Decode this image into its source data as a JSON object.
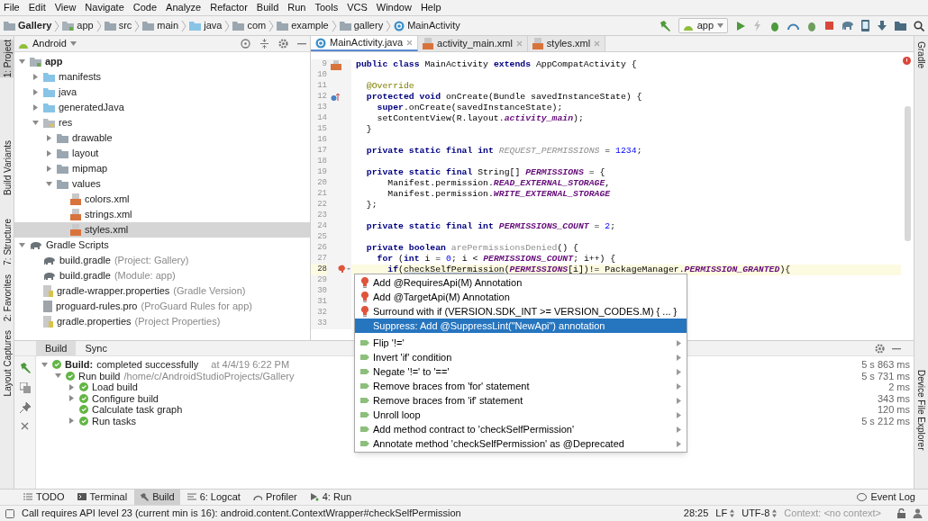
{
  "menu": [
    "File",
    "Edit",
    "View",
    "Navigate",
    "Code",
    "Analyze",
    "Refactor",
    "Build",
    "Run",
    "Tools",
    "VCS",
    "Window",
    "Help"
  ],
  "breadcrumbs": [
    {
      "label": "Gallery",
      "kind": "project"
    },
    {
      "label": "app",
      "kind": "module"
    },
    {
      "label": "src",
      "kind": "folder"
    },
    {
      "label": "main",
      "kind": "folder"
    },
    {
      "label": "java",
      "kind": "source"
    },
    {
      "label": "com",
      "kind": "folder"
    },
    {
      "label": "example",
      "kind": "folder"
    },
    {
      "label": "gallery",
      "kind": "folder"
    },
    {
      "label": "MainActivity",
      "kind": "class"
    }
  ],
  "run_config": "app",
  "left_strip": [
    {
      "label": "1: Project",
      "selected": true
    },
    {
      "label": "Build Variants",
      "selected": false
    },
    {
      "label": "7: Structure",
      "selected": false
    },
    {
      "label": "2: Favorites",
      "selected": false
    },
    {
      "label": "Layout Captures",
      "selected": false
    }
  ],
  "right_strip": [
    {
      "label": "Gradle",
      "selected": false
    },
    {
      "label": "Device File Explorer",
      "selected": false
    }
  ],
  "project_panel": {
    "view": "Android",
    "tree": [
      {
        "label": "app",
        "kind": "module",
        "expanded": true,
        "selected": false,
        "children": [
          {
            "label": "manifests",
            "kind": "source",
            "expanded": false,
            "selected": false
          },
          {
            "label": "java",
            "kind": "source",
            "expanded": false,
            "selected": false
          },
          {
            "label": "generatedJava",
            "kind": "source",
            "expanded": false,
            "selected": false
          },
          {
            "label": "res",
            "kind": "res",
            "expanded": true,
            "selected": false,
            "children": [
              {
                "label": "drawable",
                "kind": "folder",
                "expanded": false,
                "selected": false
              },
              {
                "label": "layout",
                "kind": "folder",
                "expanded": false,
                "selected": false
              },
              {
                "label": "mipmap",
                "kind": "folder",
                "expanded": false,
                "selected": false
              },
              {
                "label": "values",
                "kind": "folder",
                "expanded": true,
                "selected": false,
                "children": [
                  {
                    "label": "colors.xml",
                    "kind": "xml",
                    "selected": false
                  },
                  {
                    "label": "strings.xml",
                    "kind": "xml",
                    "selected": false
                  },
                  {
                    "label": "styles.xml",
                    "kind": "xml",
                    "selected": true
                  }
                ]
              }
            ]
          }
        ]
      },
      {
        "label": "Gradle Scripts",
        "kind": "gradle",
        "expanded": true,
        "selected": false,
        "children": [
          {
            "label": "build.gradle",
            "note": "(Project: Gallery)",
            "kind": "gradle",
            "selected": false
          },
          {
            "label": "build.gradle",
            "note": "(Module: app)",
            "kind": "gradle",
            "selected": false
          },
          {
            "label": "gradle-wrapper.properties",
            "note": "(Gradle Version)",
            "kind": "props",
            "selected": false
          },
          {
            "label": "proguard-rules.pro",
            "note": "(ProGuard Rules for app)",
            "kind": "file",
            "selected": false
          },
          {
            "label": "gradle.properties",
            "note": "(Project Properties)",
            "kind": "props",
            "selected": false
          }
        ]
      }
    ]
  },
  "editor": {
    "tabs": [
      {
        "label": "MainActivity.java",
        "kind": "class",
        "selected": true
      },
      {
        "label": "activity_main.xml",
        "kind": "xml",
        "selected": false
      },
      {
        "label": "styles.xml",
        "kind": "xml",
        "selected": false
      }
    ],
    "lines": [
      {
        "number": "9",
        "kind": "layout",
        "current": false,
        "tokens": [
          {
            "text": "public class ",
            "kind": "kw"
          },
          {
            "text": "MainActivity ",
            "kind": "plain"
          },
          {
            "text": "extends ",
            "kind": "kw"
          },
          {
            "text": "AppCompatActivity {",
            "kind": "plain"
          }
        ]
      },
      {
        "number": "10",
        "kind": "plain",
        "current": false
      },
      {
        "number": "11",
        "kind": "plain",
        "current": false,
        "tokens": [
          {
            "text": "  @Override",
            "kind": "anno"
          }
        ]
      },
      {
        "number": "12",
        "kind": "override",
        "current": false,
        "tokens": [
          {
            "text": "  protected void ",
            "kind": "kw"
          },
          {
            "text": "onCreate(Bundle savedInstanceState) {",
            "kind": "plain"
          }
        ]
      },
      {
        "number": "13",
        "kind": "plain",
        "current": false,
        "tokens": [
          {
            "text": "    super",
            "kind": "kw"
          },
          {
            "text": ".onCreate(savedInstanceState);",
            "kind": "plain"
          }
        ]
      },
      {
        "number": "14",
        "kind": "plain",
        "current": false,
        "tokens": [
          {
            "text": "    setContentView(R.layout.",
            "kind": "plain"
          },
          {
            "text": "activity_main",
            "kind": "const"
          },
          {
            "text": ");",
            "kind": "plain"
          }
        ]
      },
      {
        "number": "15",
        "kind": "plain",
        "current": false,
        "tokens": [
          {
            "text": "  }",
            "kind": "plain"
          }
        ]
      },
      {
        "number": "16",
        "kind": "plain",
        "current": false
      },
      {
        "number": "17",
        "kind": "plain",
        "current": false,
        "tokens": [
          {
            "text": "  private static final int ",
            "kind": "kw"
          },
          {
            "text": "REQUEST_PERMISSIONS",
            "kind": "unused_field"
          },
          {
            "text": " = ",
            "kind": "plain"
          },
          {
            "text": "1234",
            "kind": "num"
          },
          {
            "text": ";",
            "kind": "plain"
          }
        ]
      },
      {
        "number": "18",
        "kind": "plain",
        "current": false
      },
      {
        "number": "19",
        "kind": "plain",
        "current": false,
        "tokens": [
          {
            "text": "  private static final ",
            "kind": "kw"
          },
          {
            "text": "String[] ",
            "kind": "plain"
          },
          {
            "text": "PERMISSIONS",
            "kind": "const"
          },
          {
            "text": " = {",
            "kind": "plain"
          }
        ]
      },
      {
        "number": "20",
        "kind": "plain",
        "current": false,
        "tokens": [
          {
            "text": "      Manifest.permission.",
            "kind": "plain"
          },
          {
            "text": "READ_EXTERNAL_STORAGE",
            "kind": "const"
          },
          {
            "text": ",",
            "kind": "plain"
          }
        ]
      },
      {
        "number": "21",
        "kind": "plain",
        "current": false,
        "tokens": [
          {
            "text": "      Manifest.permission.",
            "kind": "plain"
          },
          {
            "text": "WRITE_EXTERNAL_STORAGE",
            "kind": "const"
          }
        ]
      },
      {
        "number": "22",
        "kind": "plain",
        "current": false,
        "tokens": [
          {
            "text": "  };",
            "kind": "plain"
          }
        ]
      },
      {
        "number": "23",
        "kind": "plain",
        "current": false
      },
      {
        "number": "24",
        "kind": "plain",
        "current": false,
        "tokens": [
          {
            "text": "  private static final int ",
            "kind": "kw"
          },
          {
            "text": "PERMISSIONS_COUNT",
            "kind": "const"
          },
          {
            "text": " = ",
            "kind": "plain"
          },
          {
            "text": "2",
            "kind": "num"
          },
          {
            "text": ";",
            "kind": "plain"
          }
        ]
      },
      {
        "number": "25",
        "kind": "plain",
        "current": false
      },
      {
        "number": "26",
        "kind": "plain",
        "current": false,
        "tokens": [
          {
            "text": "  private boolean ",
            "kind": "kw"
          },
          {
            "text": "arePermissionsDenied",
            "kind": "unused"
          },
          {
            "text": "() {",
            "kind": "plain"
          }
        ]
      },
      {
        "number": "27",
        "kind": "plain",
        "current": false,
        "tokens": [
          {
            "text": "    for ",
            "kind": "kw"
          },
          {
            "text": "(",
            "kind": "plain"
          },
          {
            "text": "int ",
            "kind": "kw"
          },
          {
            "text": "i = ",
            "kind": "plain"
          },
          {
            "text": "0",
            "kind": "num"
          },
          {
            "text": "; i < ",
            "kind": "plain"
          },
          {
            "text": "PERMISSIONS_COUNT",
            "kind": "const"
          },
          {
            "text": "; i++) {",
            "kind": "plain"
          }
        ]
      },
      {
        "number": "28",
        "kind": "plain",
        "current": true,
        "tokens": [
          {
            "text": "      if",
            "kind": "kw"
          },
          {
            "text": "(",
            "kind": "plain"
          },
          {
            "text": "checkSelfPermission",
            "kind": "warn"
          },
          {
            "text": "(",
            "kind": "plain"
          },
          {
            "text": "PERMISSIONS",
            "kind": "const"
          },
          {
            "text": "[i])!= PackageManager.",
            "kind": "plain"
          },
          {
            "text": "PERMISSION_GRANTED",
            "kind": "const"
          },
          {
            "text": "){",
            "kind": "plain"
          }
        ]
      },
      {
        "number": "29",
        "kind": "plain",
        "current": false
      },
      {
        "number": "30",
        "kind": "plain",
        "current": false
      },
      {
        "number": "31",
        "kind": "plain",
        "current": false
      },
      {
        "number": "32",
        "kind": "plain",
        "current": false
      },
      {
        "number": "33",
        "kind": "plain",
        "current": false
      }
    ]
  },
  "intentions": [
    {
      "label": "Add @RequiresApi(M) Annotation",
      "kind": "fix",
      "submenu": false,
      "selected": false
    },
    {
      "label": "Add @TargetApi(M) Annotation",
      "kind": "fix",
      "submenu": false,
      "selected": false
    },
    {
      "label": "Surround with if (VERSION.SDK_INT >= VERSION_CODES.M) { ... }",
      "kind": "fix",
      "submenu": false,
      "selected": false
    },
    {
      "label": "Suppress: Add @SuppressLint(\"NewApi\") annotation",
      "kind": "suppress",
      "submenu": false,
      "selected": true
    },
    {
      "label": "Flip '!='",
      "kind": "intention",
      "submenu": true,
      "selected": false
    },
    {
      "label": "Invert 'if' condition",
      "kind": "intention",
      "submenu": true,
      "selected": false
    },
    {
      "label": "Negate '!=' to '=='",
      "kind": "intention",
      "submenu": true,
      "selected": false
    },
    {
      "label": "Remove braces from 'for' statement",
      "kind": "intention",
      "submenu": true,
      "selected": false
    },
    {
      "label": "Remove braces from 'if' statement",
      "kind": "intention",
      "submenu": true,
      "selected": false
    },
    {
      "label": "Unroll loop",
      "kind": "intention",
      "submenu": true,
      "selected": false
    },
    {
      "label": "Add method contract to 'checkSelfPermission'",
      "kind": "intention",
      "submenu": true,
      "selected": false
    },
    {
      "label": "Annotate method 'checkSelfPermission' as @Deprecated",
      "kind": "intention",
      "submenu": true,
      "selected": false
    }
  ],
  "build_panel": {
    "tabs": [
      {
        "label": "Build",
        "selected": true
      },
      {
        "label": "Sync",
        "selected": false
      }
    ],
    "tree": [
      {
        "label": "Build:",
        "detail": "completed successfully",
        "note": "at 4/4/19 6:22 PM",
        "duration": "5 s 863 ms",
        "expanded": true,
        "children": [
          {
            "label": "Run build",
            "note": "/home/c/AndroidStudioProjects/Gallery",
            "duration": "5 s 731 ms",
            "expanded": true,
            "children": [
              {
                "label": "Load build",
                "duration": "2 ms",
                "expanded": false
              },
              {
                "label": "Configure build",
                "duration": "343 ms",
                "expanded": false
              },
              {
                "label": "Calculate task graph",
                "duration": "120 ms"
              },
              {
                "label": "Run tasks",
                "duration": "5 s 212 ms",
                "expanded": false
              }
            ]
          }
        ]
      }
    ]
  },
  "tool_tabs": [
    {
      "label": "TODO",
      "kind": "todo",
      "selected": false
    },
    {
      "label": "Terminal",
      "kind": "terminal",
      "selected": false
    },
    {
      "label": "Build",
      "kind": "build",
      "selected": true
    },
    {
      "label": "6: Logcat",
      "kind": "logcat",
      "selected": false
    },
    {
      "label": "Profiler",
      "kind": "profiler",
      "selected": false
    },
    {
      "label": "4: Run",
      "kind": "run",
      "selected": false
    }
  ],
  "event_log": "Event Log",
  "status_bar": {
    "message": "Call requires API level 23 (current min is 16): android.content.ContextWrapper#checkSelfPermission",
    "position": "28:25",
    "line_separator": "LF",
    "encoding": "UTF-8",
    "context": "Context: <no context>"
  }
}
